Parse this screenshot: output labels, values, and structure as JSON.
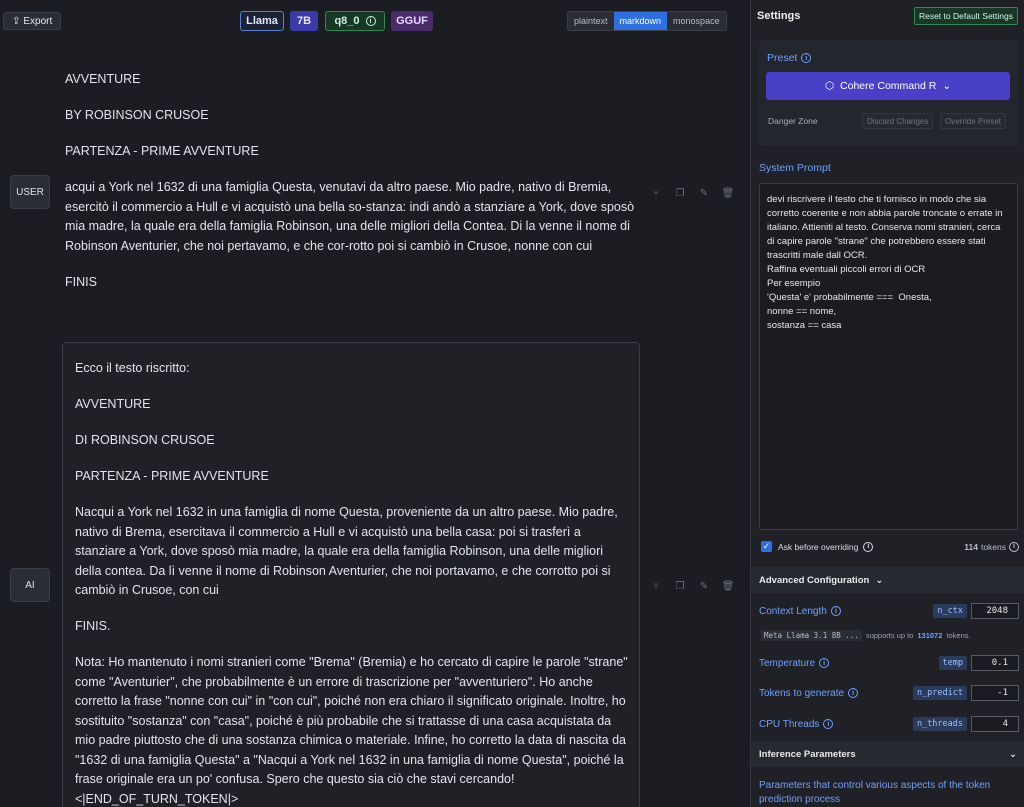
{
  "topbar": {
    "export_label": "Export",
    "badges": {
      "model": "Llama",
      "size": "7B",
      "quant": "q8_0",
      "format": "GGUF"
    },
    "format_options": [
      "plaintext",
      "markdown",
      "monospace"
    ],
    "active_format": "markdown"
  },
  "chat": {
    "user_role": "USER",
    "user_paragraphs": [
      "AVVENTURE",
      "BY ROBINSON CRUSOE",
      "PARTENZA - PRIME AVVENTURE",
      "acqui a York nel 1632 di una famiglia Questa, venutavi da altro paese. Mio padre, nativo di Bremia, esercitò il commercio a Hull e vi acquistò una bella so-stanza: indi andò a stanziare a York, dove sposò mia madre, la quale era della famiglia Robinson, una delle migliori della Contea. Di la venne il nome di Robinson Aventurier, che noi pertavamo, e che cor-rotto poi si cambiò in Crusoe, nonne con cui",
      "FINIS"
    ],
    "ai_role": "AI",
    "ai_paragraphs": [
      "Ecco il testo riscritto:",
      "AVVENTURE",
      "DI ROBINSON CRUSOE",
      "PARTENZA - PRIME AVVENTURE",
      "Nacqui a York nel 1632 in una famiglia di nome Questa, proveniente da un altro paese. Mio padre, nativo di Brema, esercitava il commercio a Hull e vi acquistò una bella casa: poi si trasferì a stanziare a York, dove sposò mia madre, la quale era della famiglia Robinson, una delle migliori della contea. Da lì venne il nome di Robinson Aventurier, che noi portavamo, e che corrotto poi si cambiò in Crusoe, con cui",
      "FINIS.",
      "Nota: Ho mantenuto i nomi stranieri come \"Brema\" (Bremia) e ho cercato di capire le parole \"strane\" come \"Aventurier\", che probabilmente è un errore di trascrizione per \"avventuriero\". Ho anche corretto la frase \"nonne con cui\" in \"con cui\", poiché non era chiaro il significato originale. Inoltre, ho sostituito \"sostanza\" con \"casa\", poiché è più probabile che si trattasse di una casa acquistata da mio padre piuttosto che di una sostanza chimica o materiale. Infine, ho corretto la data di nascita da \"1632 di una famiglia Questa\" a \"Nacqui a York nel 1632 in una famiglia di nome Questa\", poiché la frase originale era un po' confusa. Spero che questo sia ciò che stavi cercando! <|END_OF_TURN_TOKEN|>"
    ]
  },
  "settings": {
    "title": "Settings",
    "reset_label": "Reset to Default Settings",
    "preset_label": "Preset",
    "preset_value": "Cohere Command R",
    "danger_zone": "Danger Zone",
    "discard_label": "Discard Changes",
    "override_label": "Override Preset",
    "system_prompt_label": "System Prompt",
    "system_prompt": "devi riscrivere il testo che ti fornisco in modo che sia corretto coerente e non abbia parole troncate o errate in italiano. Attieniti al testo. Conserva nomi stranieri, cerca di capire parole \"strane\" che potrebbero essere stati trascritti male dall OCR.\nRaffina eventuali piccoli errori di OCR\nPer esempio\n'Questa' e' probabilmente ===  Onesta,\nnonne == nome,\nsostanza == casa",
    "ask_label": "Ask before overriding",
    "tokens_count": "114",
    "tokens_word": "tokens",
    "advanced_label": "Advanced Configuration",
    "params": {
      "ctx_label": "Context Length",
      "ctx_code": "n_ctx",
      "ctx_value": "2048",
      "ctx_note_model": "Meta Llama 3.1 8B ...",
      "ctx_note_text": "supports up to",
      "ctx_note_max": "131072",
      "ctx_note_unit": "tokens.",
      "temp_label": "Temperature",
      "temp_code": "temp",
      "temp_value": "0.1",
      "predict_label": "Tokens to generate",
      "predict_code": "n_predict",
      "predict_value": "-1",
      "threads_label": "CPU Threads",
      "threads_code": "n_threads",
      "threads_value": "4"
    },
    "inference_label": "Inference Parameters",
    "inference_desc": "Parameters that control various aspects of the token prediction process"
  }
}
